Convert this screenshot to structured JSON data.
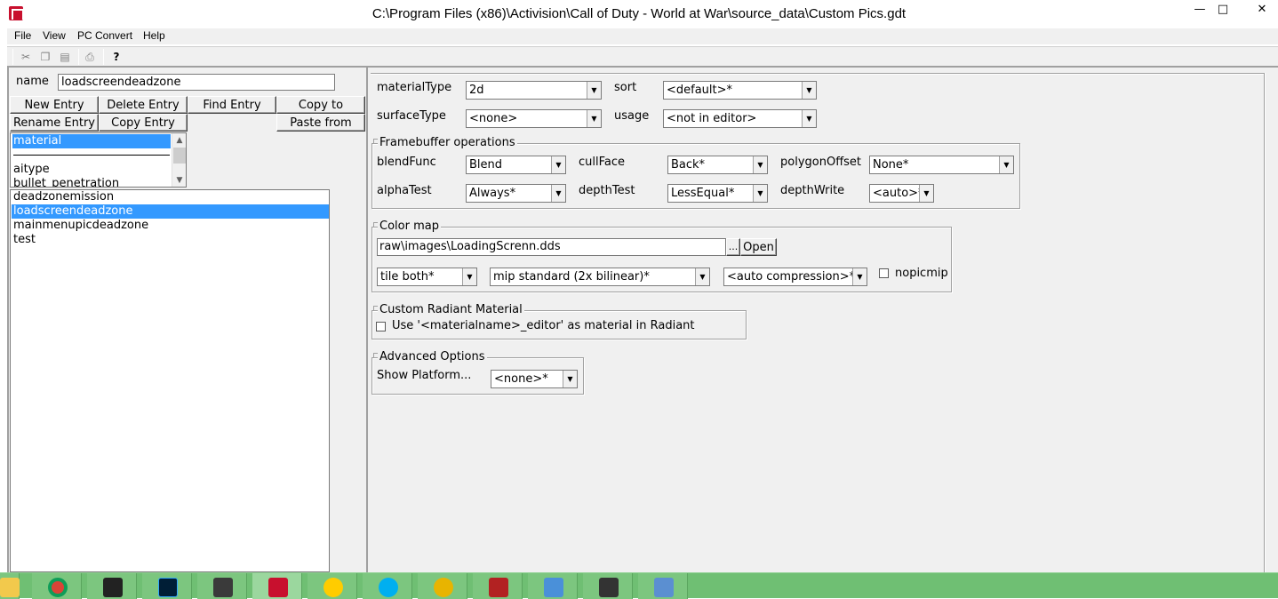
{
  "window": {
    "title": "C:\\Program Files (x86)\\Activision\\Call of Duty - World at War\\source_data\\Custom Pics.gdt",
    "minimize": "—",
    "maximize": "□",
    "close": "✕"
  },
  "menu": [
    "File",
    "View",
    "PC Convert",
    "Help"
  ],
  "toolbar": {
    "icons": [
      "cut-icon",
      "copy-icon",
      "paste-icon",
      "print-icon",
      "help-icon"
    ],
    "help_glyph": "?"
  },
  "left": {
    "name_label": "name",
    "name_value": "loadscreendeadzone",
    "buttons": {
      "new_entry": "New Entry",
      "delete_entry": "Delete Entry",
      "find_entry": "Find Entry",
      "copy_to": "Copy to",
      "rename_entry": "Rename Entry",
      "copy_entry": "Copy Entry",
      "paste_from": "Paste from"
    },
    "type_list": [
      "material",
      "",
      "aitype",
      "bullet_penetration"
    ],
    "type_selected": "material",
    "entries": [
      "deadzonemission",
      "loadscreendeadzone",
      "mainmenupicdeadzone",
      "test"
    ],
    "entry_selected": "loadscreendeadzone"
  },
  "props": {
    "materialType": {
      "label": "materialType",
      "value": "2d"
    },
    "sort": {
      "label": "sort",
      "value": "<default>*"
    },
    "surfaceType": {
      "label": "surfaceType",
      "value": "<none>"
    },
    "usage": {
      "label": "usage",
      "value": "<not in editor>"
    }
  },
  "framebuffer": {
    "title": "Framebuffer operations",
    "blendFunc": {
      "label": "blendFunc",
      "value": "Blend"
    },
    "cullFace": {
      "label": "cullFace",
      "value": "Back*"
    },
    "polygonOffset": {
      "label": "polygonOffset",
      "value": "None*"
    },
    "alphaTest": {
      "label": "alphaTest",
      "value": "Always*"
    },
    "depthTest": {
      "label": "depthTest",
      "value": "LessEqual*"
    },
    "depthWrite": {
      "label": "depthWrite",
      "value": "<auto>*"
    }
  },
  "colormap": {
    "title": "Color map",
    "path": "raw\\images\\LoadingScrenn.dds",
    "browse": "...",
    "open": "Open",
    "tile": "tile both*",
    "mip": "mip standard (2x bilinear)*",
    "compression": "<auto compression>*",
    "nopicmip": "nopicmip",
    "nopicmip_checked": false
  },
  "radiant": {
    "title": "Custom Radiant Material",
    "checkbox_label": "Use '<materialname>_editor' as material in Radiant",
    "checked": false
  },
  "advanced": {
    "title": "Advanced Options",
    "show_platform": "Show Platform...",
    "value": "<none>*"
  },
  "taskbar": {
    "apps": [
      "file-explorer-icon",
      "chrome-icon",
      "video-editor-icon",
      "photoshop-icon",
      "rocket-launcher-icon",
      "asset-manager-icon",
      "cyberghost-icon",
      "skype-icon",
      "browser-globe-icon",
      "game-app-icon",
      "paint-tool-icon",
      "media-player-icon",
      "control-panel-icon"
    ],
    "colors": {
      "bar": "#6fbf73",
      "chrome": "#db4437",
      "photoshop": "#001e36",
      "skype": "#00aff0",
      "cyberghost": "#ffcc00"
    }
  },
  "colors": {
    "selection": "#3399ff",
    "panel": "#f0f0f0",
    "app_icon": "#c8102e"
  }
}
